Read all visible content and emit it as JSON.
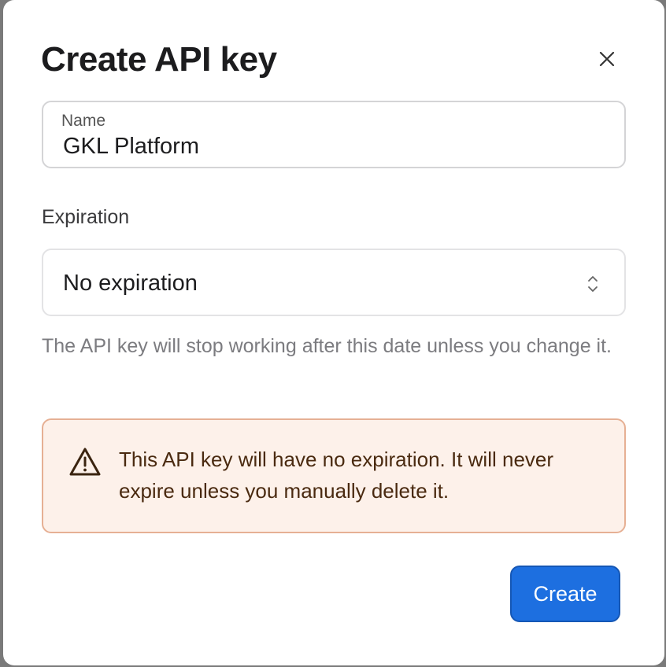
{
  "dialog": {
    "title": "Create API key",
    "close_icon": "close-icon"
  },
  "name_field": {
    "label": "Name",
    "value": "GKL Platform"
  },
  "expiration": {
    "label": "Expiration",
    "selected": "No expiration",
    "chevron_icon": "chevron-up-down-icon",
    "helper_text": "The API key will stop working after this date unless you change it."
  },
  "warning": {
    "icon": "warning-triangle-icon",
    "text": "This API key will have no expiration. It will never expire unless you manually delete it.",
    "background": "#fdf1ea",
    "border": "#e6b094"
  },
  "actions": {
    "create_label": "Create",
    "accent": "#1d6fe0"
  }
}
